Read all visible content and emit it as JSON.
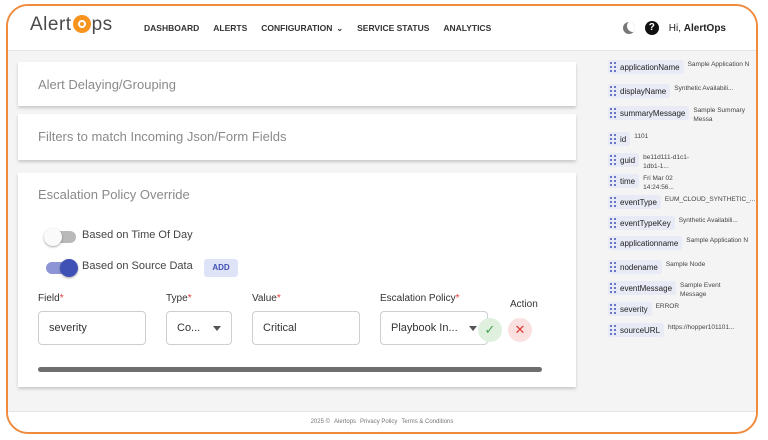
{
  "brand": {
    "logo_text_a": "Alert",
    "logo_text_b": "ps"
  },
  "nav": {
    "items": [
      {
        "label": "DASHBOARD"
      },
      {
        "label": "ALERTS"
      },
      {
        "label": "CONFIGURATION"
      },
      {
        "label": "SERVICE STATUS"
      },
      {
        "label": "ANALYTICS"
      }
    ]
  },
  "header": {
    "help_icon": "?",
    "greeting_prefix": "Hi, ",
    "user_name": "AlertOps"
  },
  "cards": {
    "delay_title": "Alert Delaying/Grouping",
    "filters_title": "Filters to match Incoming Json/Form Fields",
    "override_title": "Escalation Policy Override"
  },
  "override": {
    "toggle_time_label": "Based on Time Of Day",
    "toggle_time_on": false,
    "toggle_source_label": "Based on Source Data",
    "toggle_source_on": true,
    "add_label": "ADD",
    "field_label": "Field",
    "type_label": "Type",
    "value_label": "Value",
    "policy_label": "Escalation Policy",
    "action_label": "Action",
    "field_value": "severity",
    "type_value": "Co...",
    "value_value": "Critical",
    "policy_value": "Playbook In...",
    "required_mark": "*"
  },
  "source_fields": [
    {
      "name": "applicationName",
      "value": "Sample Application N"
    },
    {
      "name": "displayName",
      "value": "Synthetic Availabili..."
    },
    {
      "name": "summaryMessage",
      "value": "Sample Summary Messa"
    },
    {
      "name": "id",
      "value": "1101"
    },
    {
      "name": "guid",
      "value": "be11d111-d1c1-1db1-1..."
    },
    {
      "name": "time",
      "value": "Fri Mar 02 14:24:56..."
    },
    {
      "name": "eventType",
      "value": "EUM_CLOUD_SYNTHETIC_..."
    },
    {
      "name": "eventTypeKey",
      "value": "Synthetic Availabili..."
    },
    {
      "name": "applicationname",
      "value": "Sample Application N"
    },
    {
      "name": "nodename",
      "value": "Sample Node"
    },
    {
      "name": "eventMessage",
      "value": "Sample Event Message"
    },
    {
      "name": "severity",
      "value": "ERROR"
    },
    {
      "name": "sourceURL",
      "value": "https://hopper101101..."
    }
  ],
  "footer": {
    "copyright": "2025 ©",
    "company": "Alertops",
    "privacy": "Privacy Policy",
    "terms": "Terms & Conditions"
  },
  "colors": {
    "accent": "#3f51b5",
    "brand_orange": "#f7941d",
    "frame_border": "#f08a3c"
  }
}
